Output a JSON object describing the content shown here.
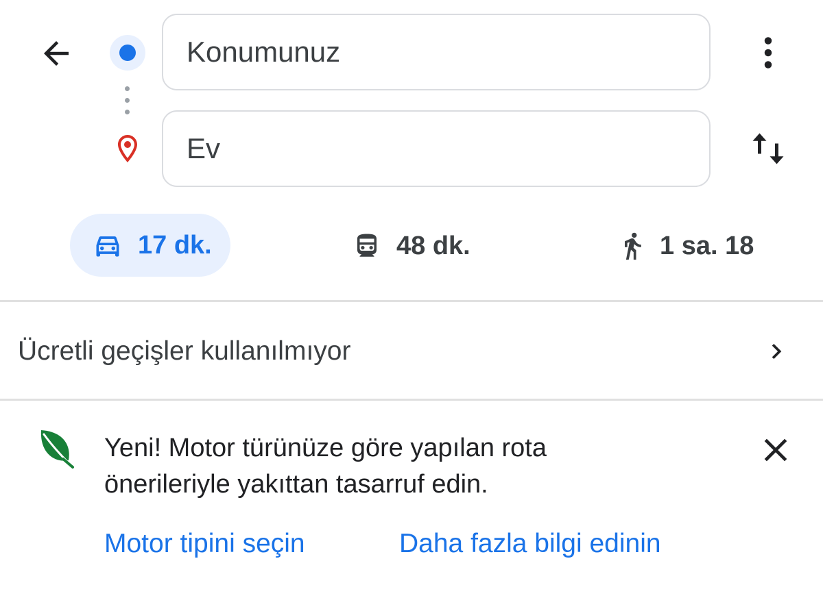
{
  "header": {
    "origin_value": "Konumunuz",
    "destination_value": "Ev"
  },
  "modes": [
    {
      "name": "car",
      "icon": "car-icon",
      "label": "17 dk.",
      "selected": true
    },
    {
      "name": "transit",
      "icon": "train-icon",
      "label": "48 dk.",
      "selected": false
    },
    {
      "name": "walk",
      "icon": "walk-icon",
      "label": "1 sa. 18",
      "selected": false
    }
  ],
  "toll_option": {
    "label": "Ücretli geçişler kullanılmıyor"
  },
  "promo": {
    "line1": "Yeni! Motor türünüze göre yapılan rota",
    "line2": "önerileriyle yakıttan tasarruf edin.",
    "action_primary": "Motor tipini seçin",
    "action_secondary": "Daha fazla bilgi edinin"
  },
  "colors": {
    "accent": "#1a73e8",
    "selected_chip_bg": "#e8f0fe",
    "origin_dot": "#1a73e8",
    "destination_pin": "#d93025",
    "leaf": "#188038"
  }
}
